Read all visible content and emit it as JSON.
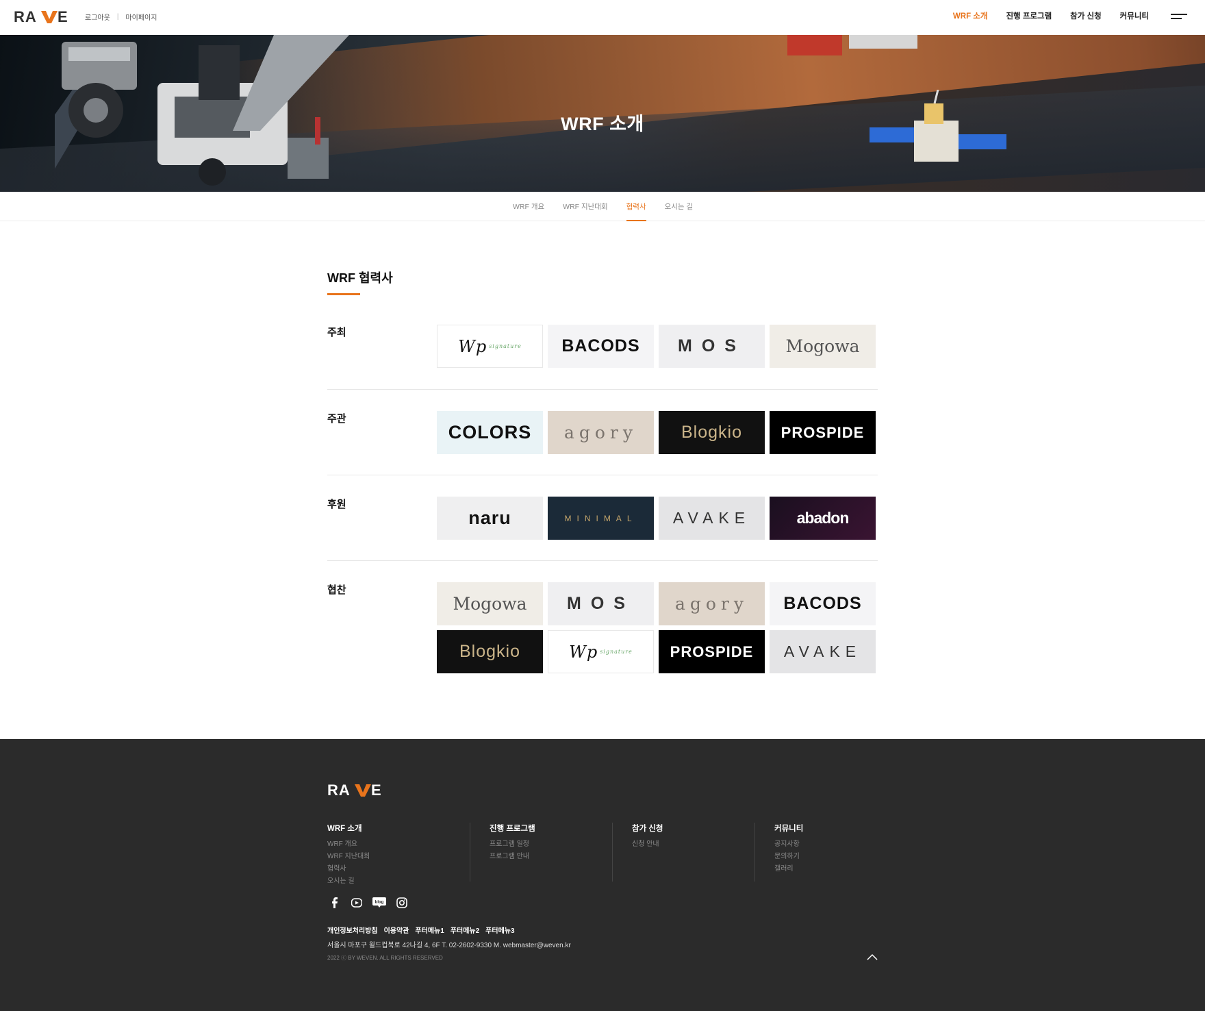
{
  "header": {
    "logo_text": "RAVE",
    "util": {
      "logout": "로그아웃",
      "separator": "|",
      "mypage": "마이페이지"
    },
    "gnb": [
      {
        "label": "WRF 소개",
        "active": true
      },
      {
        "label": "진행 프로그램",
        "active": false
      },
      {
        "label": "참가 신청",
        "active": false
      },
      {
        "label": "커뮤니티",
        "active": false
      }
    ]
  },
  "hero": {
    "title": "WRF 소개"
  },
  "subnav": [
    {
      "label": "WRF 개요",
      "active": false
    },
    {
      "label": "WRF 지난대회",
      "active": false
    },
    {
      "label": "협력사",
      "active": true
    },
    {
      "label": "오시는 길",
      "active": false
    }
  ],
  "content": {
    "title": "WRF 협력사",
    "groups": [
      {
        "label": "주최",
        "logos": [
          "Wp",
          "BACODS",
          "MOS",
          "Mogowa"
        ]
      },
      {
        "label": "주관",
        "logos": [
          "COLORS",
          "agory",
          "Blogkio",
          "PROSPIDE"
        ]
      },
      {
        "label": "후원",
        "logos": [
          "naru",
          "MINIMAL",
          "AVAKE",
          "abadon"
        ]
      },
      {
        "label": "협찬",
        "logos": [
          "Mogowa",
          "MOS",
          "agory",
          "BACODS",
          "Blogkio",
          "Wp",
          "PROSPIDE",
          "AVAKE"
        ]
      }
    ],
    "wp_sub": "signature"
  },
  "footer": {
    "logo_text": "RAVE",
    "columns": [
      {
        "title": "WRF 소개",
        "items": [
          "WRF 개요",
          "WRF 지난대회",
          "협력사",
          "오시는 길"
        ]
      },
      {
        "title": "진행 프로그램",
        "items": [
          "프로그램 일정",
          "프로그램 안내"
        ]
      },
      {
        "title": "참가 신청",
        "items": [
          "신청 안내"
        ]
      },
      {
        "title": "커뮤니티",
        "items": [
          "공지사항",
          "문의하기",
          "갤러리"
        ]
      }
    ],
    "sns": [
      "facebook-icon",
      "youtube-icon",
      "blog-icon",
      "instagram-icon"
    ],
    "blog_label": "blog",
    "links": [
      "개인정보처리방침",
      "이용약관",
      "푸터메뉴1",
      "푸터메뉴2",
      "푸터메뉴3"
    ],
    "address": "서울시 마포구 월드컵북로 42나길 4, 6F  T. 02-2602-9330 M. webmaster@weven.kr",
    "copyright": "2022 ⓒ BY WEVEN. ALL RIGHTS RESERVED"
  },
  "colors": {
    "accent": "#e8741c",
    "footer_bg": "#2b2b2b"
  }
}
